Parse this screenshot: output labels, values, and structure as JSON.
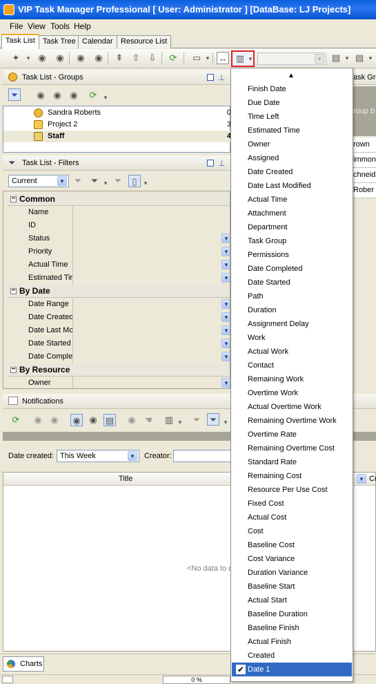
{
  "window": {
    "title": "VIP Task Manager Professional [ User: Administrator ] [DataBase: LJ Projects]"
  },
  "menu": {
    "items": [
      "File",
      "View",
      "Tools",
      "Help"
    ]
  },
  "tabs": [
    "Task List",
    "Task Tree",
    "Calendar",
    "Resource List"
  ],
  "groups_panel": {
    "title": "Task List - Groups",
    "rows": [
      {
        "name": "Sandra Roberts",
        "count": "0"
      },
      {
        "name": "Project 2",
        "count": "3"
      },
      {
        "name": "Staff",
        "count": "4"
      }
    ]
  },
  "filters_panel": {
    "title": "Task List - Filters",
    "preset": "Current",
    "categories": [
      {
        "label": "Common",
        "fields": [
          "Name",
          "ID",
          "Status",
          "Priority",
          "Actual Time",
          "Estimated Tir"
        ]
      },
      {
        "label": "By Date",
        "fields": [
          "Date Range",
          "Date Createc",
          "Date Last Mc",
          "Date Started",
          "Date Comple"
        ]
      },
      {
        "label": "By Resource",
        "fields": [
          "Owner"
        ]
      }
    ]
  },
  "notifications": {
    "title": "Notifications",
    "date_created_label": "Date created:",
    "date_created_value": "This Week",
    "creator_label": "Creator:",
    "column_title": "Title",
    "empty_text": "<No data to d"
  },
  "right_panel": {
    "header": "ask Gro",
    "group_hint": "roup b",
    "names": [
      "rown",
      "immons",
      "chneid",
      "Rober"
    ],
    "column_partial": "Cr"
  },
  "bottom": {
    "tab_label": "Charts",
    "progress": "0 %"
  },
  "columns_menu": {
    "items": [
      "Finish Date",
      "Due Date",
      "Time Left",
      "Estimated Time",
      "Owner",
      "Assigned",
      "Date Created",
      "Date Last Modified",
      "Actual Time",
      "Attachment",
      "Department",
      "Task Group",
      "Permissions",
      "Date Completed",
      "Date Started",
      "Path",
      "Duration",
      "Assignment Delay",
      "Work",
      "Actual Work",
      "Contact",
      "Remaining Work",
      "Overtime Work",
      "Actual Overtime Work",
      "Remaining Overtime Work",
      "Overtime Rate",
      "Remaining Overtime Cost",
      "Standard Rate",
      "Remaining Cost",
      "Resource Per Use Cost",
      "Fixed Cost",
      "Actual Cost",
      "Cost",
      "Baseline Cost",
      "Cost Variance",
      "Duration Variance",
      "Baseline Start",
      "Actual Start",
      "Baseline Duration",
      "Baseline Finish",
      "Actual Finish",
      "Created",
      "Date 1"
    ],
    "checked_item": "Date 1"
  },
  "colors": {
    "title_bar": "#0a5fdc",
    "selection": "#316ac5",
    "highlight_border": "#e02020"
  }
}
